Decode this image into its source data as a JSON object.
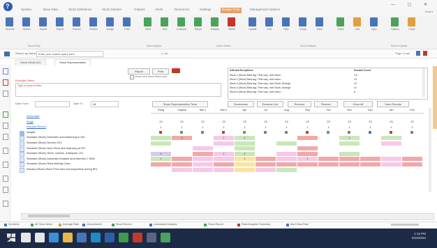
{
  "ribbon_tabs": [
    "System",
    "Base Data",
    "Stock Definitions",
    "Stock Dataset",
    "Outputs",
    "Alerts",
    "Resources",
    "Settings",
    "Design Tools",
    "Management Options"
  ],
  "active_tab_index": 8,
  "ribbon_buttons": [
    "Save All",
    "Search",
    "Import",
    "Export",
    "Record",
    "Review",
    "Assign",
    "Print",
    "Clear",
    "New",
    "Compare",
    "Report",
    "Analyse",
    "Delete",
    "Update",
    "Edit",
    "Filter",
    "Group",
    "Rank",
    "Rules",
    "Link",
    "Sync",
    "Options",
    "Close"
  ],
  "ribbon_groups": [
    "Stock Entry",
    "Data Analysis",
    "Action Status",
    "Stock Analysis",
    "Record Update"
  ],
  "window_controls": "— ▢ ✕",
  "account": "Help ▾",
  "address_bar": {
    "search_label": "Search by Name",
    "search_value": "Enter your search query here",
    "page": "1  |  ◂  ▸",
    "right": "Page Count"
  },
  "doc_tabs": [
    "Stock Detail (01)",
    "Stock Representation"
  ],
  "form": {
    "report_label": "Report",
    "print_label": "Print",
    "excluded_label": "Excluded Items",
    "excluded_value": "Type a name to filter...",
    "show_zero_label": "Show zero stock items only",
    "from_label": "Date From",
    "to_label": "Date To",
    "from_value": "",
    "to_value": "All"
  },
  "detection_list": {
    "col1": "Affected Exceptions",
    "col2": "Domain Count",
    "rows": [
      {
        "name": "Stock-1 (Stock) Beta tag: Time vary, next return",
        "count": "2.6"
      },
      {
        "name": "Stock-2 (Stock) Beta tag: Time vary, next return",
        "count": "13"
      },
      {
        "name": "Stock-3 (Stock) Beta tag: Time vary, next Stock, Arrange",
        "count": "12"
      },
      {
        "name": "Stock-4 (Stock) Beta tag: Time vary, next Stock, Arrange",
        "count": "14"
      },
      {
        "name": "Stock-5 (Stock) Beta tag: Time vary, next return",
        "count": "8"
      }
    ]
  },
  "grid_toolbar": [
    "Show Representation Tools",
    "Summarise",
    "Rename List",
    "Remove",
    "Restore",
    "Clear All",
    "Save Results"
  ],
  "grid": {
    "columns": [
      "Filing",
      "Caption",
      "Mkt 1",
      "Mar 2",
      "Apr",
      "Jul",
      "Aug",
      "Sep",
      "Oct",
      "Nov",
      "Dec",
      "Jan",
      "Feb"
    ],
    "rows": [
      {
        "label": "Stock Date",
        "link": true,
        "cells": [
          "",
          "",
          "",
          "",
          "",
          "",
          "",
          "",
          "",
          "",
          "",
          "",
          ""
        ],
        "colors": [
          "",
          "",
          "",
          "",
          "",
          "",
          "",
          "",
          "",
          "",
          "",
          "",
          ""
        ]
      },
      {
        "label": "Stage",
        "link": true,
        "cells": [
          "23",
          "23",
          "23",
          "23",
          "23",
          "23",
          "23",
          "23",
          "23",
          "23",
          "23",
          "23",
          "23"
        ],
        "colors": [
          "",
          "",
          "",
          "",
          "",
          "",
          "",
          "",
          "",
          "",
          "",
          "",
          ""
        ]
      },
      {
        "label": "Exercise Record",
        "link": true,
        "cells": [
          "1",
          "1",
          "1",
          "1",
          "1",
          "1",
          "1",
          "1",
          "1",
          "1",
          "1",
          "1",
          "1"
        ],
        "colors": [
          "",
          "",
          "",
          "",
          "",
          "",
          "",
          "",
          "",
          "",
          "",
          "",
          ""
        ]
      },
      {
        "label": "Images",
        "link": false,
        "cells": [
          "",
          "",
          "",
          "",
          "",
          "",
          "",
          "",
          "",
          "",
          "",
          "",
          ""
        ],
        "colors": [
          "",
          "",
          "",
          "",
          "",
          "",
          "",
          "",
          "",
          "",
          "",
          "",
          ""
        ]
      },
      {
        "label": "Standard (Stock) Automatic area balancing in 040",
        "link": false,
        "cells": [
          "",
          "1",
          "",
          "1",
          "1",
          "",
          "",
          "",
          "",
          "1",
          "",
          "",
          ""
        ],
        "colors": [
          "#c9e7b8",
          "#f2a8a8",
          "",
          "#f7c8e8",
          "#c9e7b8",
          "",
          "",
          "#f2a8a8",
          "",
          "#c9e7b8",
          "",
          "#c9e7b8",
          ""
        ]
      },
      {
        "label": "Standard (Stock) Number 201",
        "link": false,
        "cells": [
          "",
          "",
          "",
          "",
          "",
          "",
          "",
          "",
          "",
          "",
          "",
          "",
          ""
        ],
        "colors": [
          "#c9e7b8",
          "",
          "",
          "#f7c8e8",
          "#c9e7b8",
          "",
          "#c9e7b8",
          "",
          "",
          "#c9e7b8",
          "",
          "#f7c8e8",
          ""
        ]
      },
      {
        "label": "Standard (Stock) Next Stock and balancing at 201",
        "link": false,
        "cells": [
          "",
          "",
          "",
          "",
          "",
          "",
          "",
          "",
          "",
          "",
          "",
          "",
          ""
        ],
        "colors": [
          "",
          "",
          "#f7c8e8",
          "",
          "#c9e7b8",
          "",
          "",
          "#f2a8a8",
          "",
          "",
          "",
          "",
          ""
        ]
      },
      {
        "label": "Standard (Stock) Stock, solution, Anticipate, 201",
        "link": false,
        "cells": [
          "1",
          "",
          "",
          "1",
          "1",
          "",
          "",
          "",
          "",
          "",
          "",
          "",
          ""
        ],
        "colors": [
          "#d7c8f0",
          "",
          "#f2a8a8",
          "#f7c8e8",
          "#c9e7b8",
          "",
          "#f7c8e8",
          "#f2a8a8",
          "",
          "#c9e7b8",
          "",
          "",
          ""
        ]
      },
      {
        "label": "Standard (Stock) Automatic Analysis area Attentive 2 SMA",
        "link": false,
        "cells": [
          "1",
          "",
          "",
          "",
          "1",
          "",
          "",
          "1",
          "",
          "",
          "",
          "",
          ""
        ],
        "colors": [
          "#c9e7b8",
          "#f2a8a8",
          "#f7c8e8",
          "#f7c8e8",
          "#fbe3a0",
          "#f2a8a8",
          "#f7c8e8",
          "#f7c8e8",
          "#f2a8a8",
          "#f2a8a8",
          "#f2a8a8",
          "#f7c8e8",
          "#f2a8a8"
        ]
      },
      {
        "label": "Standard (Stock) Rank starting Close",
        "link": false,
        "cells": [
          "",
          "",
          "",
          "",
          "",
          "",
          "",
          "",
          "",
          "",
          "",
          "",
          ""
        ],
        "colors": [
          "#f2a8a8",
          "#f2a8a8",
          "#f7c8e8",
          "#f2a8a8",
          "#fbe3a0",
          "#f2a8a8",
          "#f2a8a8",
          "#f2a8a8",
          "#f2a8a8",
          "#f2a8a8",
          "#f2a8a8",
          "#f7c8e8",
          "#f2a8a8"
        ]
      },
      {
        "label": "Industry (Stock) Stock Price area and Acquisition during BPL",
        "link": false,
        "cells": [
          "",
          "",
          "",
          "",
          "",
          "",
          "",
          "",
          "",
          "",
          "",
          "",
          ""
        ],
        "colors": [
          "",
          "#f7c8e8",
          "#f7c8e8",
          "#f7c8e8",
          "#fbe3a0",
          "#f7c8e8",
          "#c9e7b8",
          "",
          "",
          "",
          "",
          "",
          ""
        ]
      }
    ]
  },
  "status_bar": [
    "No Alerts",
    "All Stock Items",
    "Average Rate",
    "Unmonitored",
    "Stock Record",
    "Automated Analysis",
    "Stock Report",
    "Rate/Analytics Summary",
    "Alert Data Rate"
  ],
  "clock": {
    "time": "1:15 PM",
    "date": "5/15/2023"
  },
  "colors": {
    "accent": "#e8a06a",
    "taskbar": "#1c2a45",
    "link": "#2a66c2"
  }
}
